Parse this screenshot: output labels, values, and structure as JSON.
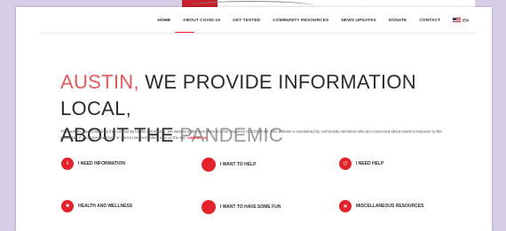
{
  "nav": {
    "items": [
      "HOME",
      "ABOUT COVID-19",
      "GET TESTED",
      "COMMUNITY RESOURCES",
      "NEWS UPDATES",
      "DONATE",
      "CONTACT",
      "EN"
    ]
  },
  "hero": {
    "line1_accent": "AUSTIN,",
    "line1_rest": " WE PROVIDE INFORMATION LOCAL,",
    "line2_rest": "ABOUT THE ",
    "line2_light": "PANDEMIC"
  },
  "intro": {
    "text": "This website was created by the community for the community. We want to make sure there is a fair response to COVID-19. This website is maintained by community members who are concerned about Austin's response to the pandemic. If you have questions or want to see something else on the site,",
    "link": "contact us."
  },
  "links": [
    {
      "label": "I NEED INFORMATION",
      "icon": "info-icon",
      "glyph": "i"
    },
    {
      "label": "I WANT TO HELP",
      "icon": "help-icon",
      "glyph": ""
    },
    {
      "label": "I NEED HELP",
      "icon": "heart-icon",
      "glyph": "♡"
    },
    {
      "label": "HEALTH AND WELLNESS",
      "icon": "health-icon",
      "glyph": "■"
    },
    {
      "label": "I WANT TO HAVE SOME FUN",
      "icon": "fun-icon",
      "glyph": ""
    },
    {
      "label": "MISCELLANEOUS RESOURCES",
      "icon": "tools-icon",
      "glyph": "✕"
    }
  ],
  "colors": {
    "accent": "#e3222b",
    "background": "#d6cfe6"
  }
}
